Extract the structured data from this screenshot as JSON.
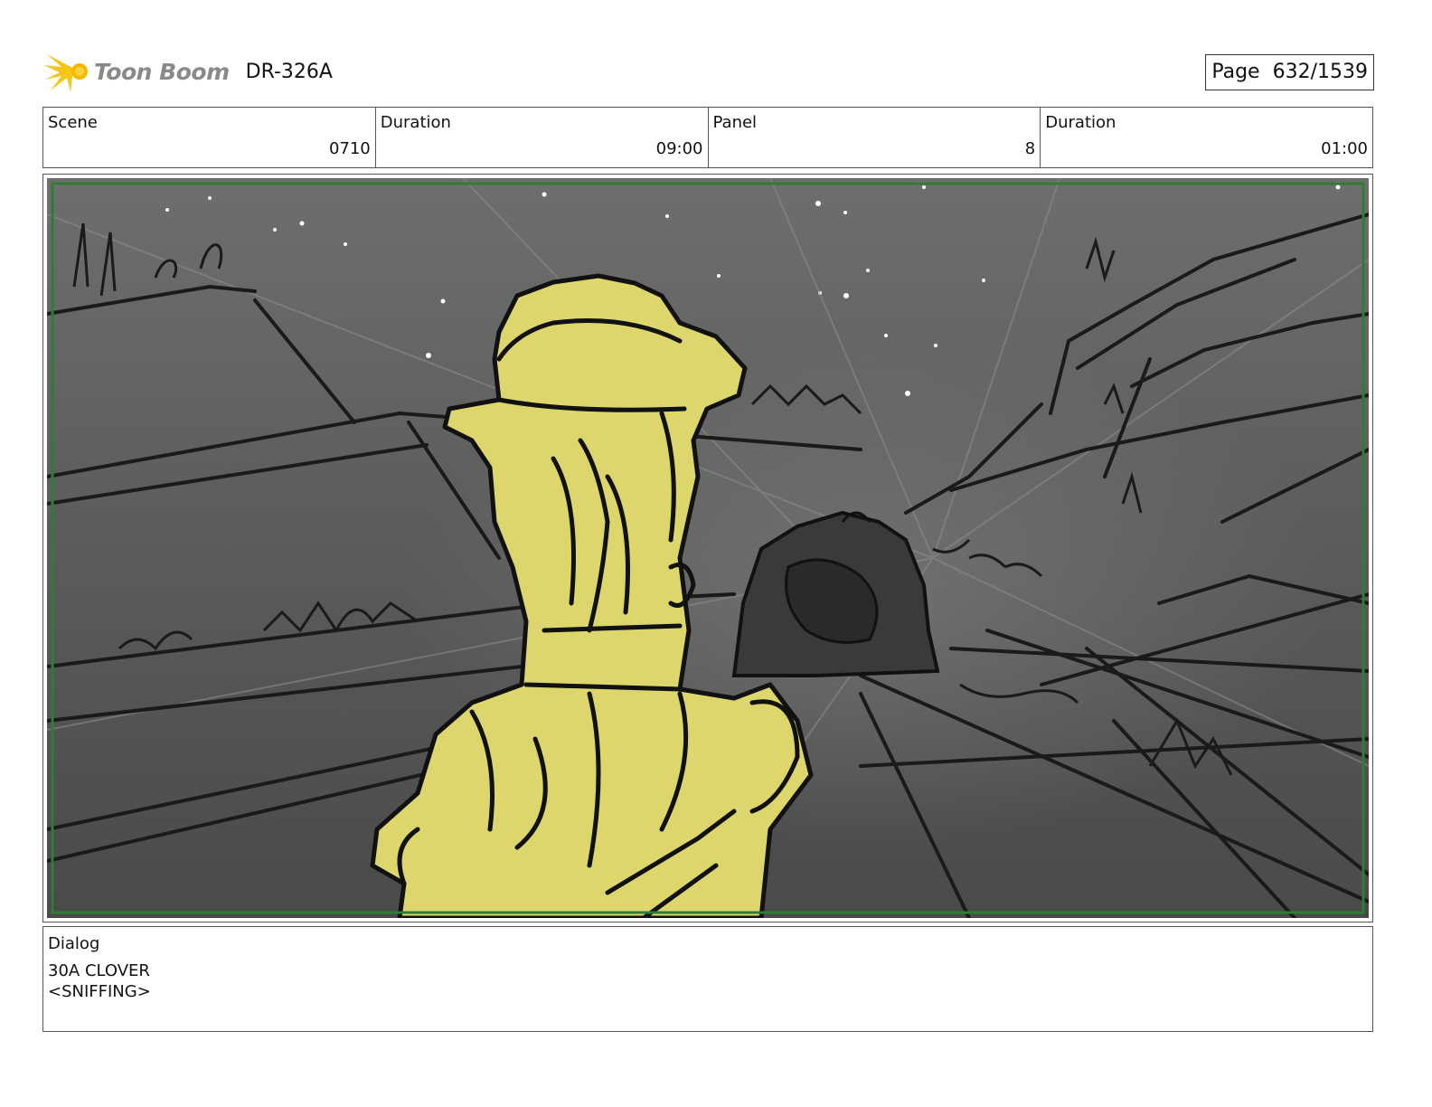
{
  "header": {
    "brand": "Toon Boom",
    "code": "DR-326A",
    "page_label": "Page",
    "page_value": "632/1539"
  },
  "info": {
    "scene_label": "Scene",
    "scene_value": "0710",
    "duration1_label": "Duration",
    "duration1_value": "09:00",
    "panel_label": "Panel",
    "panel_value": "8",
    "duration2_label": "Duration",
    "duration2_value": "01:00"
  },
  "dialog": {
    "label": "Dialog",
    "line1": "30A CLOVER",
    "line2": "<SNIFFING>"
  },
  "colors": {
    "character_fill": "#dcd66c",
    "frame_border": "#2e7d32",
    "sky_top": "#6a6a6a",
    "ground": "#4a4a4a"
  },
  "icons": {
    "logo": "toon-boom-starburst-icon"
  }
}
